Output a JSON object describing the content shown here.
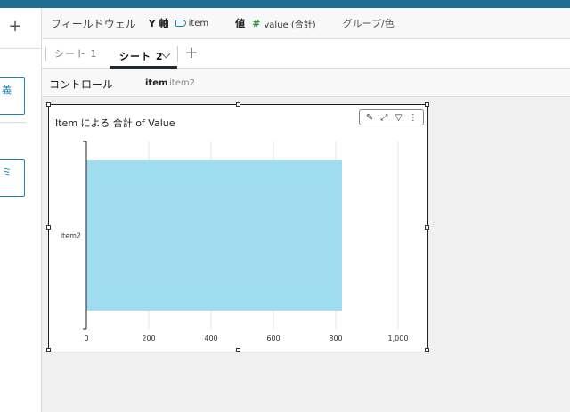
{
  "left_panel": {
    "add_label": "+",
    "cards": [
      {
        "label": "義"
      },
      {
        "label": "ミ"
      }
    ]
  },
  "field_wells": {
    "title": "フィールドウェル",
    "y_axis_label": "Y 軸",
    "y_axis_value": "item",
    "value_label": "値",
    "value_field": "value (合計)",
    "group_label": "グループ/色"
  },
  "sheets": {
    "tabs": [
      {
        "label": "シート 1",
        "active": false
      },
      {
        "label": "シート 2",
        "active": true
      }
    ],
    "add_label": "+"
  },
  "controls": {
    "title": "コントロール",
    "filter_name": "item",
    "filter_value": "item2"
  },
  "visual": {
    "menu_icons": [
      "pencil-icon",
      "expand-icon",
      "filter-icon",
      "more-icon"
    ],
    "menu_glyphs": [
      "✎",
      "⤢",
      "▽",
      "⋮"
    ]
  },
  "chart_data": {
    "type": "bar",
    "orientation": "horizontal",
    "title": "Item による 合計 of Value",
    "categories": [
      "item2"
    ],
    "values": [
      820
    ],
    "xlim": [
      0,
      1000
    ],
    "ticks": [
      0,
      200,
      400,
      600,
      800,
      1000
    ],
    "tick_labels": [
      "0",
      "200",
      "400",
      "600",
      "800",
      "1,000"
    ],
    "grid": true,
    "bar_color": "#9fdcf0"
  }
}
